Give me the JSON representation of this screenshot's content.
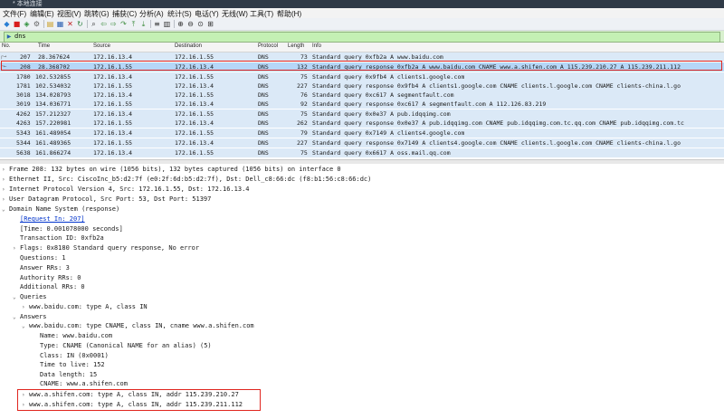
{
  "window": {
    "title": "* 本地连接"
  },
  "menu": [
    "文件(F)",
    "编辑(E)",
    "视图(V)",
    "跳转(G)",
    "捕获(C)",
    "分析(A)",
    "统计(S)",
    "电话(Y)",
    "无线(W)",
    "工具(T)",
    "帮助(H)"
  ],
  "toolbar_icons": [
    "shark-fin-start-icon",
    "stop-square-icon",
    "restart-icon",
    "options-gear-icon",
    "open-folder-icon",
    "save-icon",
    "close-file-icon",
    "reload-icon",
    "find-icon",
    "back-arrow-icon",
    "forward-arrow-icon",
    "goto-packet-icon",
    "first-packet-icon",
    "last-packet-icon",
    "autoscroll-icon",
    "colorize-icon",
    "zoom-in-icon",
    "zoom-out-icon",
    "zoom-normal-icon",
    "resize-columns-icon"
  ],
  "filter": {
    "value": "dns"
  },
  "packet_list": {
    "columns": [
      "No.",
      "Time",
      "Source",
      "Destination",
      "Protocol",
      "Length",
      "Info"
    ],
    "rows": [
      {
        "no": "207",
        "time": "28.367624",
        "src": "172.16.13.4",
        "dst": "172.16.1.55",
        "proto": "DNS",
        "len": "73",
        "info": "Standard query 0xfb2a A www.baidu.com"
      },
      {
        "no": "208",
        "time": "28.368702",
        "src": "172.16.1.55",
        "dst": "172.16.13.4",
        "proto": "DNS",
        "len": "132",
        "info": "Standard query response 0xfb2a A www.baidu.com CNAME www.a.shifen.com A 115.239.210.27 A 115.239.211.112"
      },
      {
        "no": "1780",
        "time": "102.532855",
        "src": "172.16.13.4",
        "dst": "172.16.1.55",
        "proto": "DNS",
        "len": "75",
        "info": "Standard query 0x9fb4 A clients1.google.com"
      },
      {
        "no": "1781",
        "time": "102.534032",
        "src": "172.16.1.55",
        "dst": "172.16.13.4",
        "proto": "DNS",
        "len": "227",
        "info": "Standard query response 0x9fb4 A clients1.google.com CNAME clients.l.google.com CNAME clients-china.l.go"
      },
      {
        "no": "3018",
        "time": "134.028793",
        "src": "172.16.13.4",
        "dst": "172.16.1.55",
        "proto": "DNS",
        "len": "76",
        "info": "Standard query 0xc617 A segmentfault.com"
      },
      {
        "no": "3019",
        "time": "134.036771",
        "src": "172.16.1.55",
        "dst": "172.16.13.4",
        "proto": "DNS",
        "len": "92",
        "info": "Standard query response 0xc617 A segmentfault.com A 112.126.83.219"
      },
      {
        "no": "4262",
        "time": "157.212327",
        "src": "172.16.13.4",
        "dst": "172.16.1.55",
        "proto": "DNS",
        "len": "75",
        "info": "Standard query 0x0e37 A pub.idqqimg.com"
      },
      {
        "no": "4263",
        "time": "157.220981",
        "src": "172.16.1.55",
        "dst": "172.16.13.4",
        "proto": "DNS",
        "len": "262",
        "info": "Standard query response 0x0e37 A pub.idqqimg.com CNAME pub.idqqimg.com.tc.qq.com CNAME pub.idqqimg.com.tc"
      },
      {
        "no": "5343",
        "time": "161.489054",
        "src": "172.16.13.4",
        "dst": "172.16.1.55",
        "proto": "DNS",
        "len": "79",
        "info": "Standard query 0x7149 A clients4.google.com"
      },
      {
        "no": "5344",
        "time": "161.489365",
        "src": "172.16.1.55",
        "dst": "172.16.13.4",
        "proto": "DNS",
        "len": "227",
        "info": "Standard query response 0x7149 A clients4.google.com CNAME clients.l.google.com CNAME clients-china.l.go"
      },
      {
        "no": "5638",
        "time": "161.866274",
        "src": "172.16.13.4",
        "dst": "172.16.1.55",
        "proto": "DNS",
        "len": "75",
        "info": "Standard query 0x6617 A oss.mail.qq.com"
      }
    ]
  },
  "details": [
    {
      "tri": "›",
      "text": "Frame 208: 132 bytes on wire (1056 bits), 132 bytes captured (1056 bits) on interface 0"
    },
    {
      "tri": "›",
      "text": "Ethernet II, Src: CiscoInc_b5:d2:7f (e0:2f:6d:b5:d2:7f), Dst: Dell_c8:66:dc (f8:b1:56:c8:66:dc)"
    },
    {
      "tri": "›",
      "text": "Internet Protocol Version 4, Src: 172.16.1.55, Dst: 172.16.13.4"
    },
    {
      "tri": "›",
      "text": "User Datagram Protocol, Src Port: 53, Dst Port: 51397"
    },
    {
      "tri": "⌄",
      "text": "Domain Name System (response)"
    },
    {
      "tri": "",
      "text": "[Request In: 207]",
      "link": true
    },
    {
      "tri": "",
      "text": "[Time: 0.001078000 seconds]"
    },
    {
      "tri": "",
      "text": "Transaction ID: 0xfb2a"
    },
    {
      "tri": "›",
      "text": "Flags: 0x8180 Standard query response, No error"
    },
    {
      "tri": "",
      "text": "Questions: 1"
    },
    {
      "tri": "",
      "text": "Answer RRs: 3"
    },
    {
      "tri": "",
      "text": "Authority RRs: 0"
    },
    {
      "tri": "",
      "text": "Additional RRs: 0"
    },
    {
      "tri": "⌄",
      "text": "Queries"
    },
    {
      "tri": "›",
      "text": "www.baidu.com: type A, class IN"
    },
    {
      "tri": "⌄",
      "text": "Answers"
    },
    {
      "tri": "⌄",
      "text": "www.baidu.com: type CNAME, class IN, cname www.a.shifen.com"
    },
    {
      "tri": "",
      "text": "Name: www.baidu.com"
    },
    {
      "tri": "",
      "text": "Type: CNAME (Canonical NAME for an alias) (5)"
    },
    {
      "tri": "",
      "text": "Class: IN (0x0001)"
    },
    {
      "tri": "",
      "text": "Time to live: 152"
    },
    {
      "tri": "",
      "text": "Data length: 15"
    },
    {
      "tri": "",
      "text": "CNAME: www.a.shifen.com"
    },
    {
      "tri": "›",
      "text": "www.a.shifen.com: type A, class IN, addr 115.239.210.27"
    },
    {
      "tri": "›",
      "text": "www.a.shifen.com: type A, class IN, addr 115.239.211.112"
    }
  ],
  "colors": {
    "row_bg": "#dbe9f7",
    "selected_row_bg": "#b6d7f8",
    "filter_bg": "#c4f0b4",
    "highlight_box": "#e0261f",
    "link": "#0033cc"
  }
}
